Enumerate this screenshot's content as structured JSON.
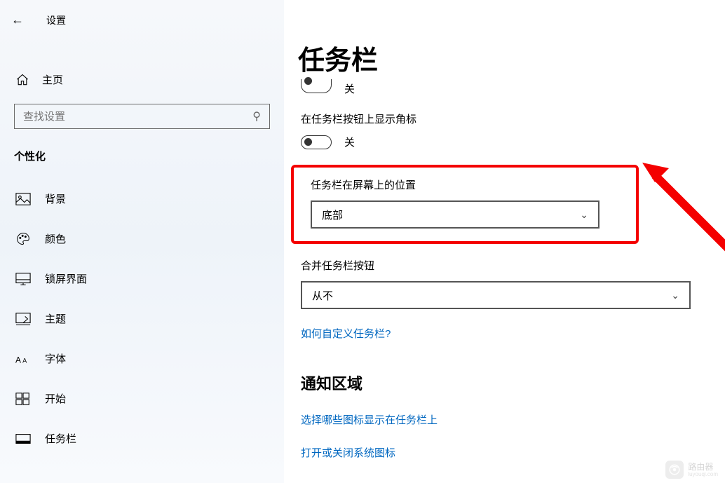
{
  "header": {
    "title": "设置"
  },
  "home": {
    "label": "主页"
  },
  "search": {
    "placeholder": "查找设置"
  },
  "category": {
    "title": "个性化"
  },
  "nav": {
    "items": [
      {
        "label": "背景"
      },
      {
        "label": "颜色"
      },
      {
        "label": "锁屏界面"
      },
      {
        "label": "主题"
      },
      {
        "label": "字体"
      },
      {
        "label": "开始"
      },
      {
        "label": "任务栏"
      }
    ]
  },
  "main": {
    "title": "任务栏",
    "toggle1": {
      "state": "off",
      "label": "关"
    },
    "badgeLabel": "在任务栏按钮上显示角标",
    "toggle2": {
      "state": "off",
      "label": "关"
    },
    "positionLabel": "任务栏在屏幕上的位置",
    "positionValue": "底部",
    "combineLabel": "合并任务栏按钮",
    "combineValue": "从不",
    "customizeLink": "如何自定义任务栏?",
    "notifyTitle": "通知区域",
    "linkIcons": "选择哪些图标显示在任务栏上",
    "linkSystem": "打开或关闭系统图标"
  },
  "watermark": {
    "text": "路由器",
    "sub": "luyouqi.com"
  }
}
